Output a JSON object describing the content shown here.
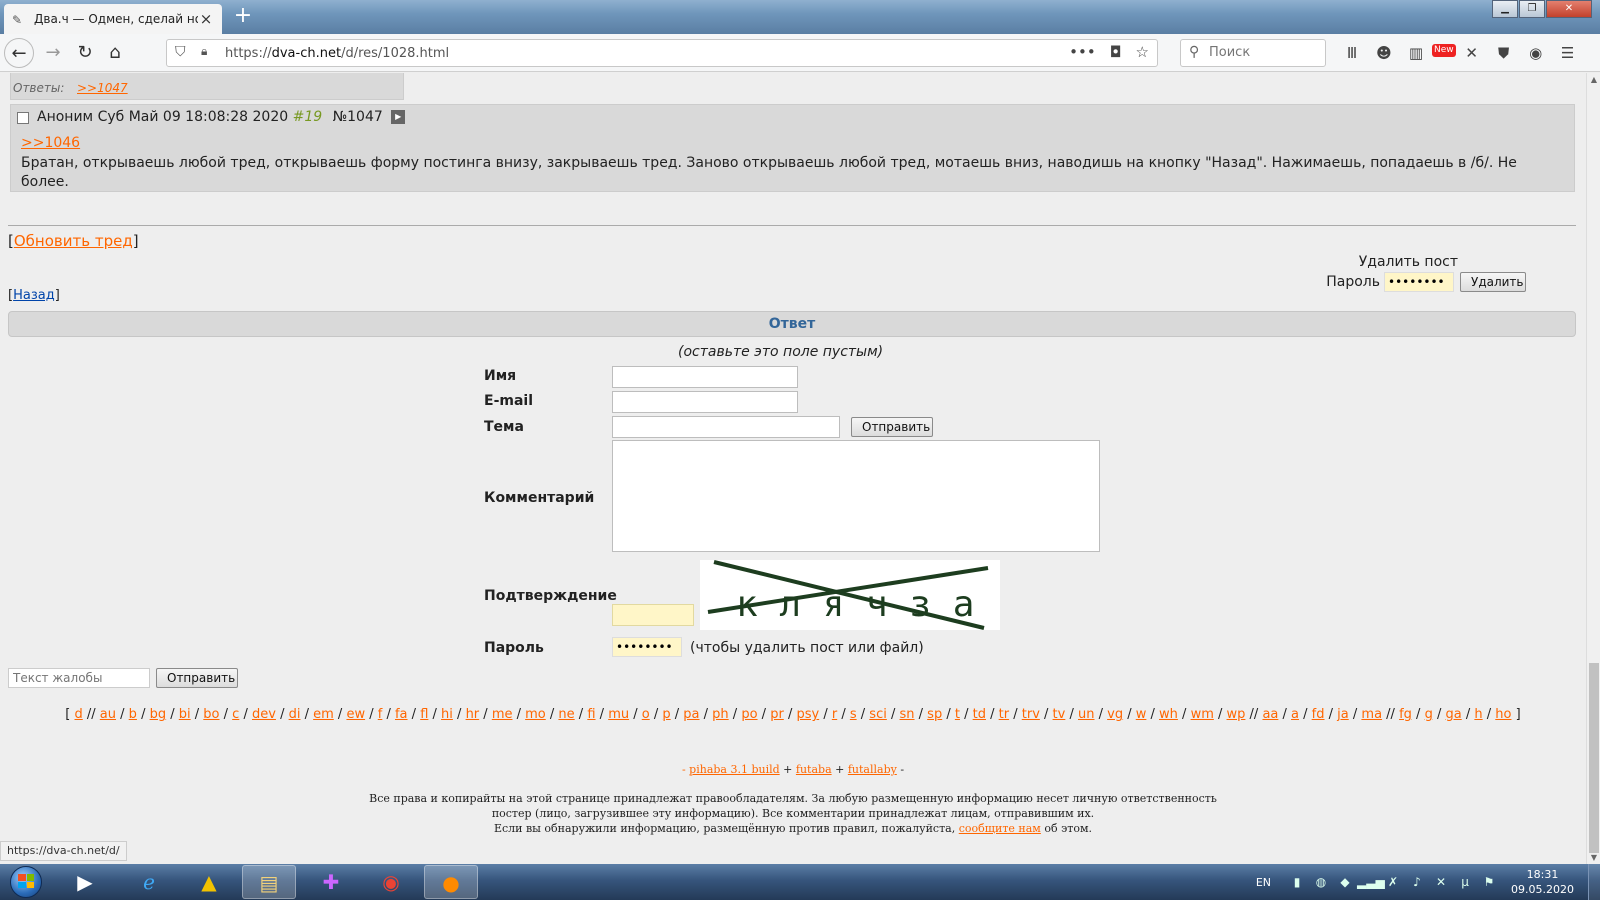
{
  "browser": {
    "tab_title": "Два.ч — Одмен, сделай норма",
    "url_prefix": "https://",
    "url_host": "dva-ch.net",
    "url_path": "/d/res/1028.html",
    "search_placeholder": "Поиск",
    "new_badge": "New",
    "status_link": "https://dva-ch.net/d/"
  },
  "thread": {
    "replies_label": "Ответы:",
    "replies_link": ">>1047",
    "post": {
      "author": "Аноним",
      "date": "Суб Май 09 18:08:28 2020",
      "index": "#19",
      "number": "№1047",
      "reply_ref": ">>1046",
      "message": "Братан, открываешь любой тред, открываешь форму постинга внизу, закрываешь тред. Заново открываешь любой тред, мотаешь вниз, наводишь на кнопку \"Назад\". Нажимаешь, попадаешь в /б/. Не более."
    },
    "refresh_link": "Обновить тред",
    "back_link": "Назад"
  },
  "delete_post": {
    "title": "Удалить пост",
    "password_label": "Пароль",
    "password_value": "••••••••",
    "button": "Удалить"
  },
  "reply_form": {
    "title": "Ответ",
    "hint": "(оставьте это поле пустым)",
    "name_label": "Имя",
    "email_label": "E-mail",
    "subject_label": "Тема",
    "submit_button": "Отправить",
    "comment_label": "Комментарий",
    "captcha_label": "Подтверждение",
    "captcha_text": "к л я ч з а",
    "password_label": "Пароль",
    "password_value": "••••••••",
    "password_note": "(чтобы удалить пост или файл)"
  },
  "complaint": {
    "placeholder": "Текст жалобы",
    "button": "Отправить"
  },
  "boards": {
    "groups": [
      [
        "d"
      ],
      [
        "au",
        "b",
        "bg",
        "bi",
        "bo",
        "c",
        "dev",
        "di",
        "em",
        "ew",
        "f",
        "fa",
        "fl",
        "hi",
        "hr",
        "me",
        "mo",
        "ne",
        "fi",
        "mu",
        "o",
        "p",
        "pa",
        "ph",
        "po",
        "pr",
        "psy",
        "r",
        "s",
        "sci",
        "sn",
        "sp",
        "t",
        "td",
        "tr",
        "trv",
        "tv",
        "un",
        "vg",
        "w",
        "wh",
        "wm",
        "wp"
      ],
      [
        "aa",
        "a",
        "fd",
        "ja",
        "ma"
      ],
      [
        "fg",
        "g",
        "ga",
        "h",
        "ho"
      ]
    ]
  },
  "footer": {
    "credit_prefix": "- ",
    "credit_1": "pihaba 3.1 build",
    "credit_sep": " + ",
    "credit_2": "futaba",
    "credit_3": "futallaby",
    "credit_suffix": " -",
    "legal_1": "Все права и копирайты на этой странице принадлежат правообладателям. За любую размещенную информацию несет личную ответственность",
    "legal_2": "постер (лицо, загрузившее эту информацию). Все комментарии принадлежат лицам, отправившим их.",
    "legal_3_pre": "Если вы обнаружили информацию, размещённую против правил, пожалуйста, ",
    "legal_3_link": "сообщите нам",
    "legal_3_post": " об этом."
  },
  "taskbar": {
    "language": "EN",
    "time": "18:31",
    "date": "09.05.2020"
  },
  "colors": {
    "link": "#ff6600",
    "post_bg": "#d9d9d9",
    "page_bg": "#eeeeee",
    "reply_title": "#336699"
  }
}
